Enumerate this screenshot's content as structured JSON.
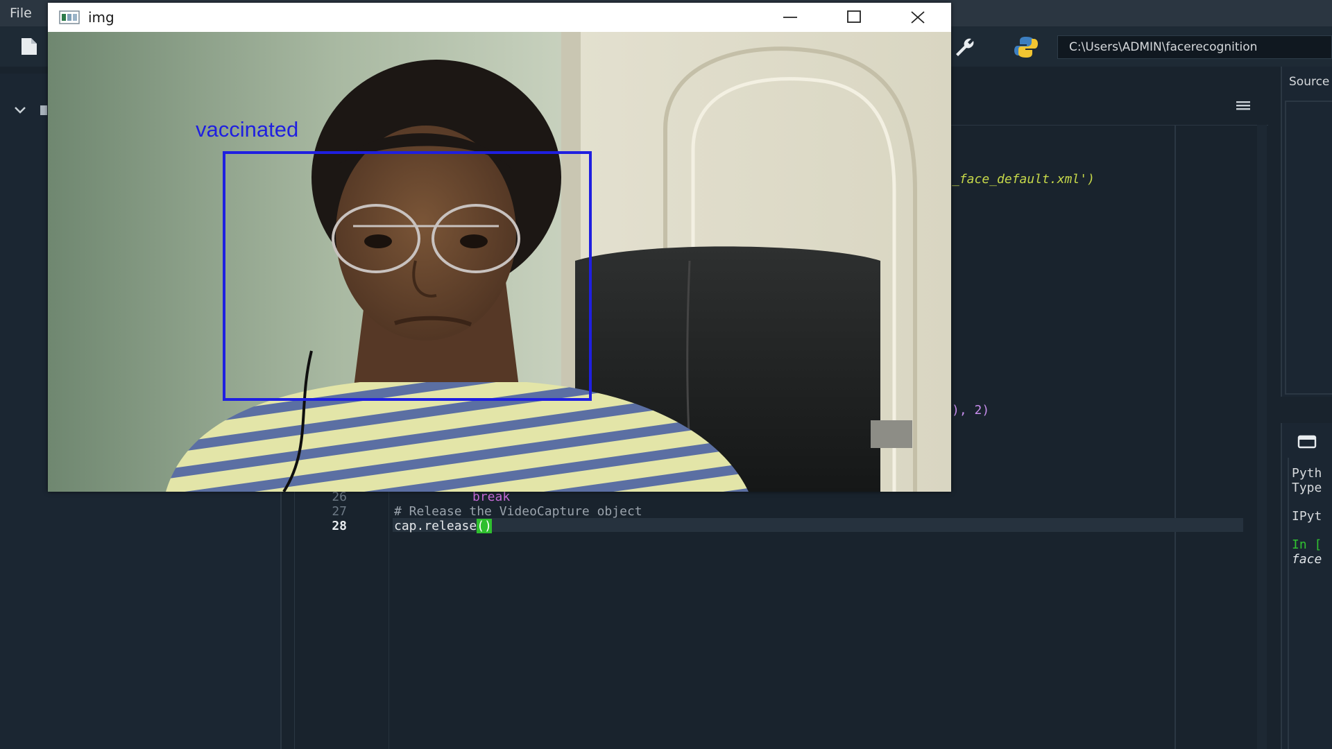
{
  "ide": {
    "menu": {
      "file": "File"
    },
    "toolbar": {
      "path": "C:\\Users\\ADMIN\\facerecognition"
    },
    "right_pane": {
      "source_label": "Source"
    },
    "console": {
      "line1": "Pyth",
      "line2": "Type",
      "line3": "IPyt",
      "prompt": "In [",
      "face": "face"
    },
    "editor": {
      "partial_line_1": "_face_default.xml')",
      "partial_line_2": "), 2)",
      "lines": [
        {
          "num": "26",
          "text": "break"
        },
        {
          "num": "27",
          "text": "# Release the VideoCapture object"
        },
        {
          "num": "28",
          "text": "cap.release",
          "paren": "()"
        }
      ]
    }
  },
  "cv_window": {
    "title": "img",
    "detection_label": "vaccinated",
    "box_color": "#1f1fe0"
  }
}
